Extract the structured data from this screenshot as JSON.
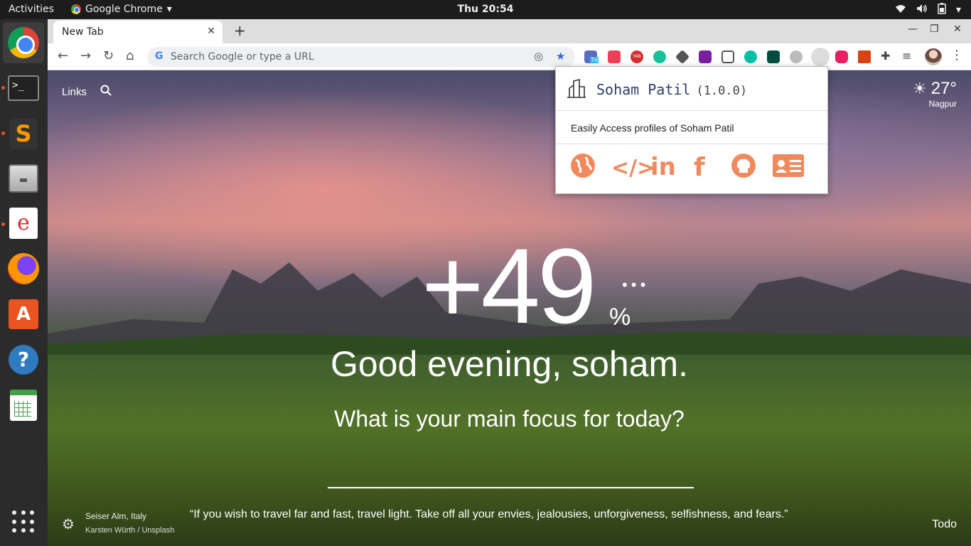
{
  "topbar": {
    "activities": "Activities",
    "app_name": "Google Chrome",
    "clock": "Thu 20:54"
  },
  "browser": {
    "tab_title": "New Tab",
    "omnibox_placeholder": "Search Google or type a URL",
    "ext_badge": "7d",
    "ext_yab": "YAB"
  },
  "page": {
    "links_label": "Links",
    "weather_temp": "27°",
    "weather_city": "Nagpur",
    "big_number": "+49",
    "percent_sign": "%",
    "greeting": "Good evening, soham.",
    "focus_question": "What is your main focus for today?",
    "photo_location": "Seiser Alm, Italy",
    "photo_credit": "Karsten Würth / Unsplash",
    "quote": "“If you wish to travel far and fast, travel light. Take off all your envies, jealousies, unforgiveness, selfishness, and fears.”",
    "todo_label": "Todo"
  },
  "popup": {
    "title": "Soham Patil",
    "version": "(1.0.0)",
    "description": "Easily Access profiles of Soham Patil",
    "links": [
      "website",
      "code",
      "linkedin",
      "facebook",
      "github",
      "resume"
    ]
  },
  "colors": {
    "accent_orange": "#f08a5d",
    "ubuntu_orange": "#e95420",
    "popup_title": "#2c3e6e"
  }
}
